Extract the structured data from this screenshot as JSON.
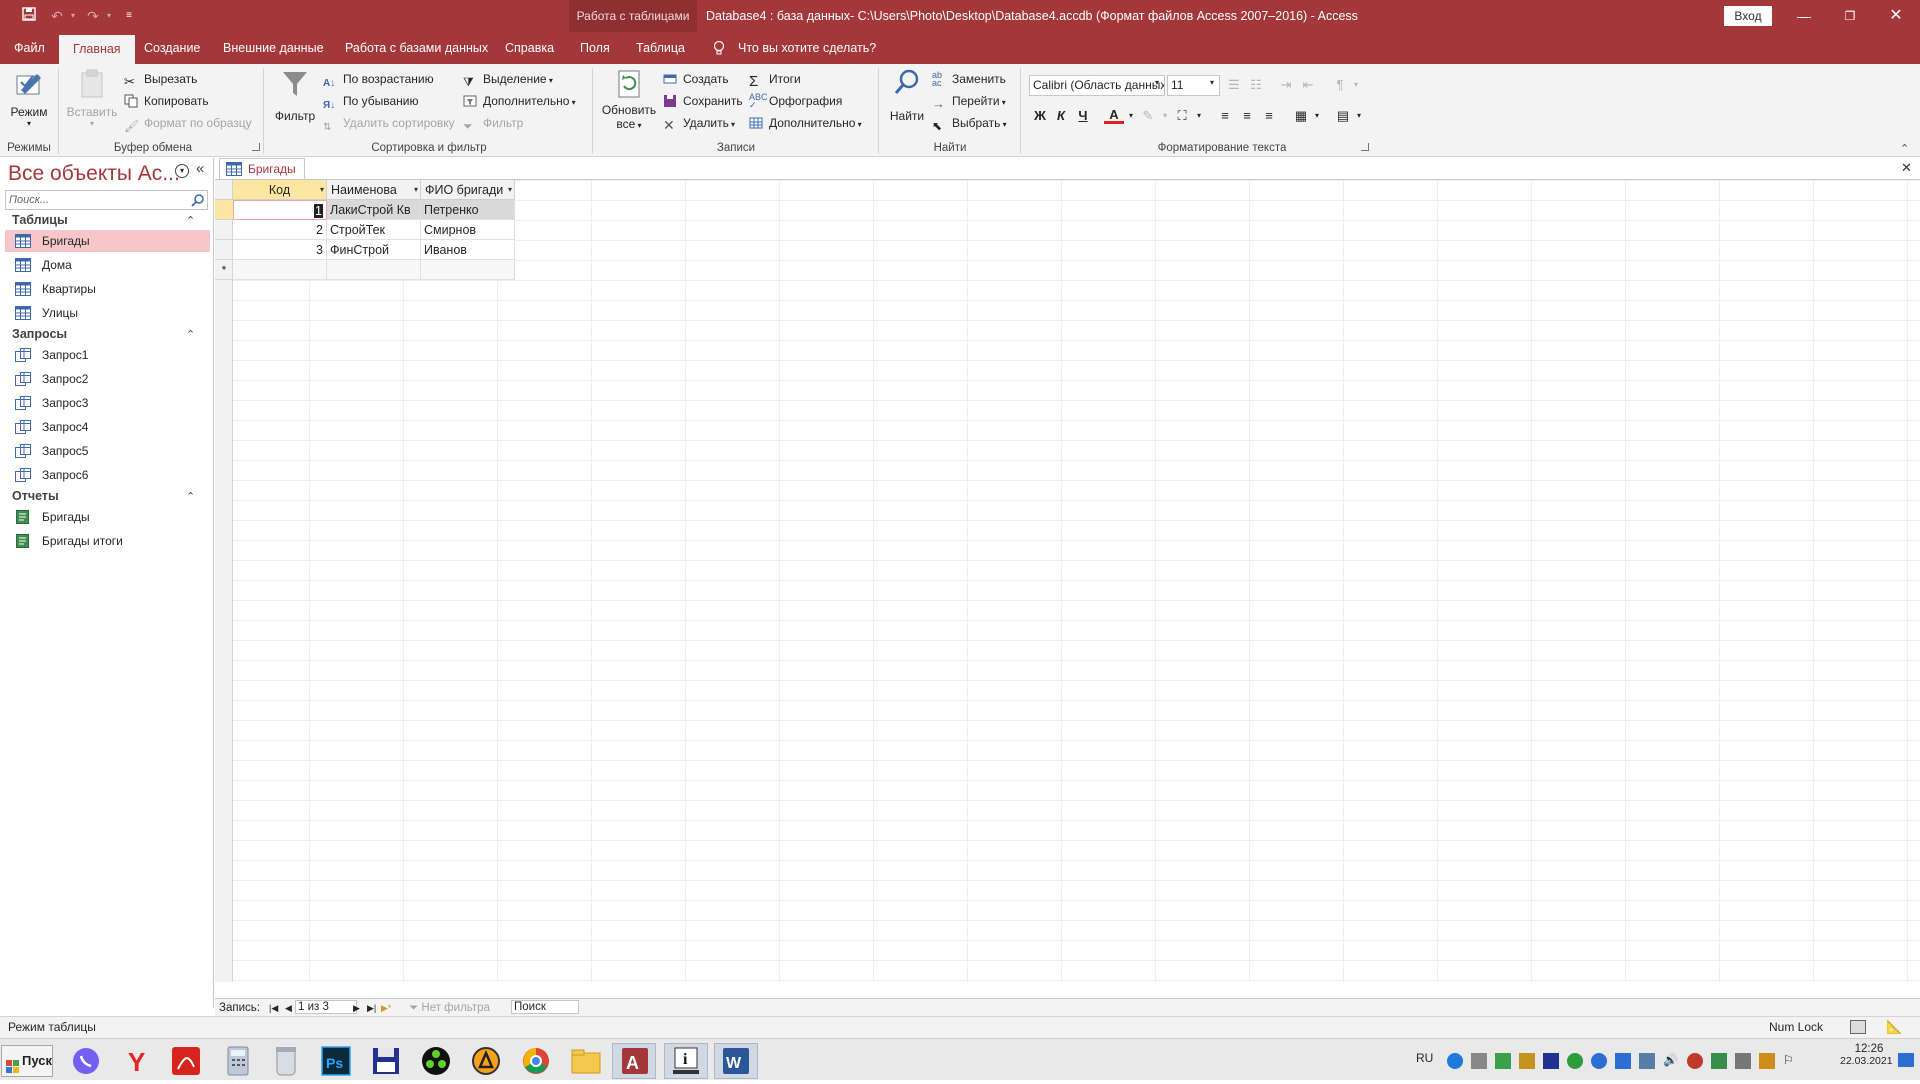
{
  "titlebar": {
    "context_tab": "Работа с таблицами",
    "document_title": "Database4 : база данных- C:\\Users\\Photo\\Desktop\\Database4.accdb (Формат файлов Access 2007–2016)  -  Access",
    "signin": "Вход",
    "colors": {
      "brand": "#a4373a"
    }
  },
  "tabs": [
    {
      "label": "Файл"
    },
    {
      "label": "Главная"
    },
    {
      "label": "Создание"
    },
    {
      "label": "Внешние данные"
    },
    {
      "label": "Работа с базами данных"
    },
    {
      "label": "Справка"
    },
    {
      "label": "Поля"
    },
    {
      "label": "Таблица"
    }
  ],
  "tellme": "Что вы хотите сделать?",
  "ribbon": {
    "modes": {
      "view": "Режим",
      "group": "Режимы"
    },
    "clipboard": {
      "paste": "Вставить",
      "cut": "Вырезать",
      "copy": "Копировать",
      "format_painter": "Формат по образцу",
      "group": "Буфер обмена"
    },
    "sortfilter": {
      "filter": "Фильтр",
      "ascending": "По возрастанию",
      "descending": "По убыванию",
      "remove_sort": "Удалить сортировку",
      "selection": "Выделение",
      "advanced": "Дополнительно",
      "toggle_filter": "Фильтр",
      "group": "Сортировка и фильтр"
    },
    "records": {
      "refresh_l1": "Обновить",
      "refresh_l2": "все",
      "new": "Создать",
      "save": "Сохранить",
      "delete": "Удалить",
      "totals": "Итоги",
      "spelling": "Орфография",
      "more": "Дополнительно",
      "group": "Записи"
    },
    "find": {
      "find": "Найти",
      "replace": "Заменить",
      "goto": "Перейти",
      "select": "Выбрать",
      "group": "Найти"
    },
    "text": {
      "font": "Calibri (Область данных)",
      "size": "11",
      "bold": "Ж",
      "italic": "К",
      "underline": "Ч",
      "group": "Форматирование текста"
    }
  },
  "nav": {
    "title": "Все объекты Ac...",
    "search_placeholder": "Поиск...",
    "categories": [
      {
        "name": "Таблицы",
        "items": [
          "Бригады",
          "Дома",
          "Квартиры",
          "Улицы"
        ]
      },
      {
        "name": "Запросы",
        "items": [
          "Запрос1",
          "Запрос2",
          "Запрос3",
          "Запрос4",
          "Запрос5",
          "Запрос6"
        ]
      },
      {
        "name": "Отчеты",
        "items": [
          "Бригады",
          "Бригады итоги"
        ]
      }
    ],
    "selected": "Бригады"
  },
  "document": {
    "tab_label": "Бригады",
    "columns": [
      "Код",
      "Наименова",
      "ФИО бригади"
    ],
    "rows": [
      {
        "code": "1",
        "name": "ЛакиСтрой Кв",
        "foreman": "Петренко"
      },
      {
        "code": "2",
        "name": "СтройТек",
        "foreman": "Смирнов"
      },
      {
        "code": "3",
        "name": "ФинСтрой",
        "foreman": "Иванов"
      }
    ],
    "new_row_marker": "*"
  },
  "recordnav": {
    "label": "Запись:",
    "position": "1 из 3",
    "filter": "Нет фильтра",
    "search": "Поиск"
  },
  "status": {
    "mode": "Режим таблицы",
    "numlock": "Num Lock"
  },
  "taskbar": {
    "start": "Пуск",
    "lang": "RU",
    "time": "12:26",
    "date": "22.03.2021"
  }
}
